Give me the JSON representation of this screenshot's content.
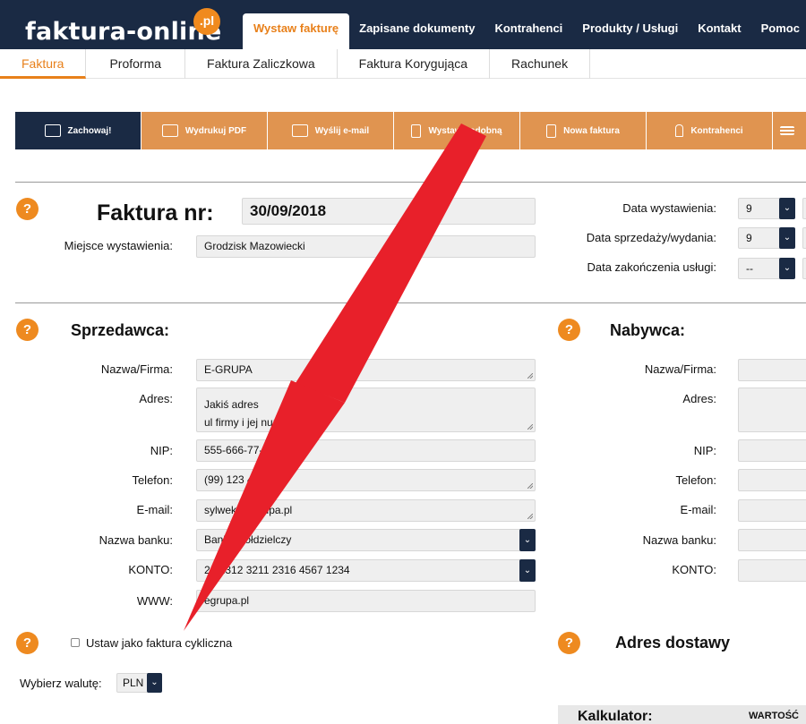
{
  "brand": {
    "logo": "faktura-online",
    "logo_badge": ".pl"
  },
  "topnav": [
    "Wystaw fakturę",
    "Zapisane dokumenty",
    "Kontrahenci",
    "Produkty / Usługi",
    "Kontakt",
    "Pomoc"
  ],
  "subtabs": [
    "Faktura",
    "Proforma",
    "Faktura Zaliczkowa",
    "Faktura Korygująca",
    "Rachunek"
  ],
  "toolbar": [
    "Zachowaj!",
    "Wydrukuj PDF",
    "Wyślij e-mail",
    "Wystaw podobną",
    "Nowa faktura",
    "Kontrahenci",
    ""
  ],
  "invoice": {
    "help": "?",
    "title": "Faktura nr:",
    "number": "30/09/2018",
    "place_label": "Miejsce wystawienia:",
    "place": "Grodzisk Mazowiecki"
  },
  "dates": {
    "issue_label": "Data wystawienia:",
    "issue_value": "9",
    "sale_label": "Data sprzedaży/wydania:",
    "sale_value": "9",
    "end_label": "Data zakończenia usługi:",
    "end_value": "--"
  },
  "seller": {
    "title": "Sprzedawca:",
    "name_label": "Nazwa/Firma:",
    "name": "E-GRUPA",
    "address_label": "Adres:",
    "address_line1": "Jakiś adres",
    "address_line2": "ul firmy i jej num",
    "nip_label": "NIP:",
    "nip": "555-666-77-8",
    "phone_label": "Telefon:",
    "phone": "(99) 123 4",
    "email_label": "E-mail:",
    "email": "sylwek@egrupa.pl",
    "bank_label": "Nazwa banku:",
    "bank": "Bank Spółdzielczy",
    "account_label": "KONTO:",
    "account": "26 1312 3211 2316 4567 1234",
    "www_label": "WWW:",
    "www": "egrupa.pl"
  },
  "buyer": {
    "title": "Nabywca:",
    "name_label": "Nazwa/Firma:",
    "address_label": "Adres:",
    "nip_label": "NIP:",
    "phone_label": "Telefon:",
    "email_label": "E-mail:",
    "bank_label": "Nazwa banku:",
    "account_label": "KONTO:"
  },
  "cyclic_label": "Ustaw jako faktura cykliczna",
  "delivery_title": "Adres dostawy",
  "currency": {
    "label": "Wybierz walutę:",
    "value": "PLN"
  },
  "calculator": {
    "title": "Kalkulator:",
    "col": "WARTOŚĆ"
  },
  "colors": {
    "navy": "#1a2a44",
    "orange": "#e8801a",
    "arrow": "#e8202a"
  }
}
